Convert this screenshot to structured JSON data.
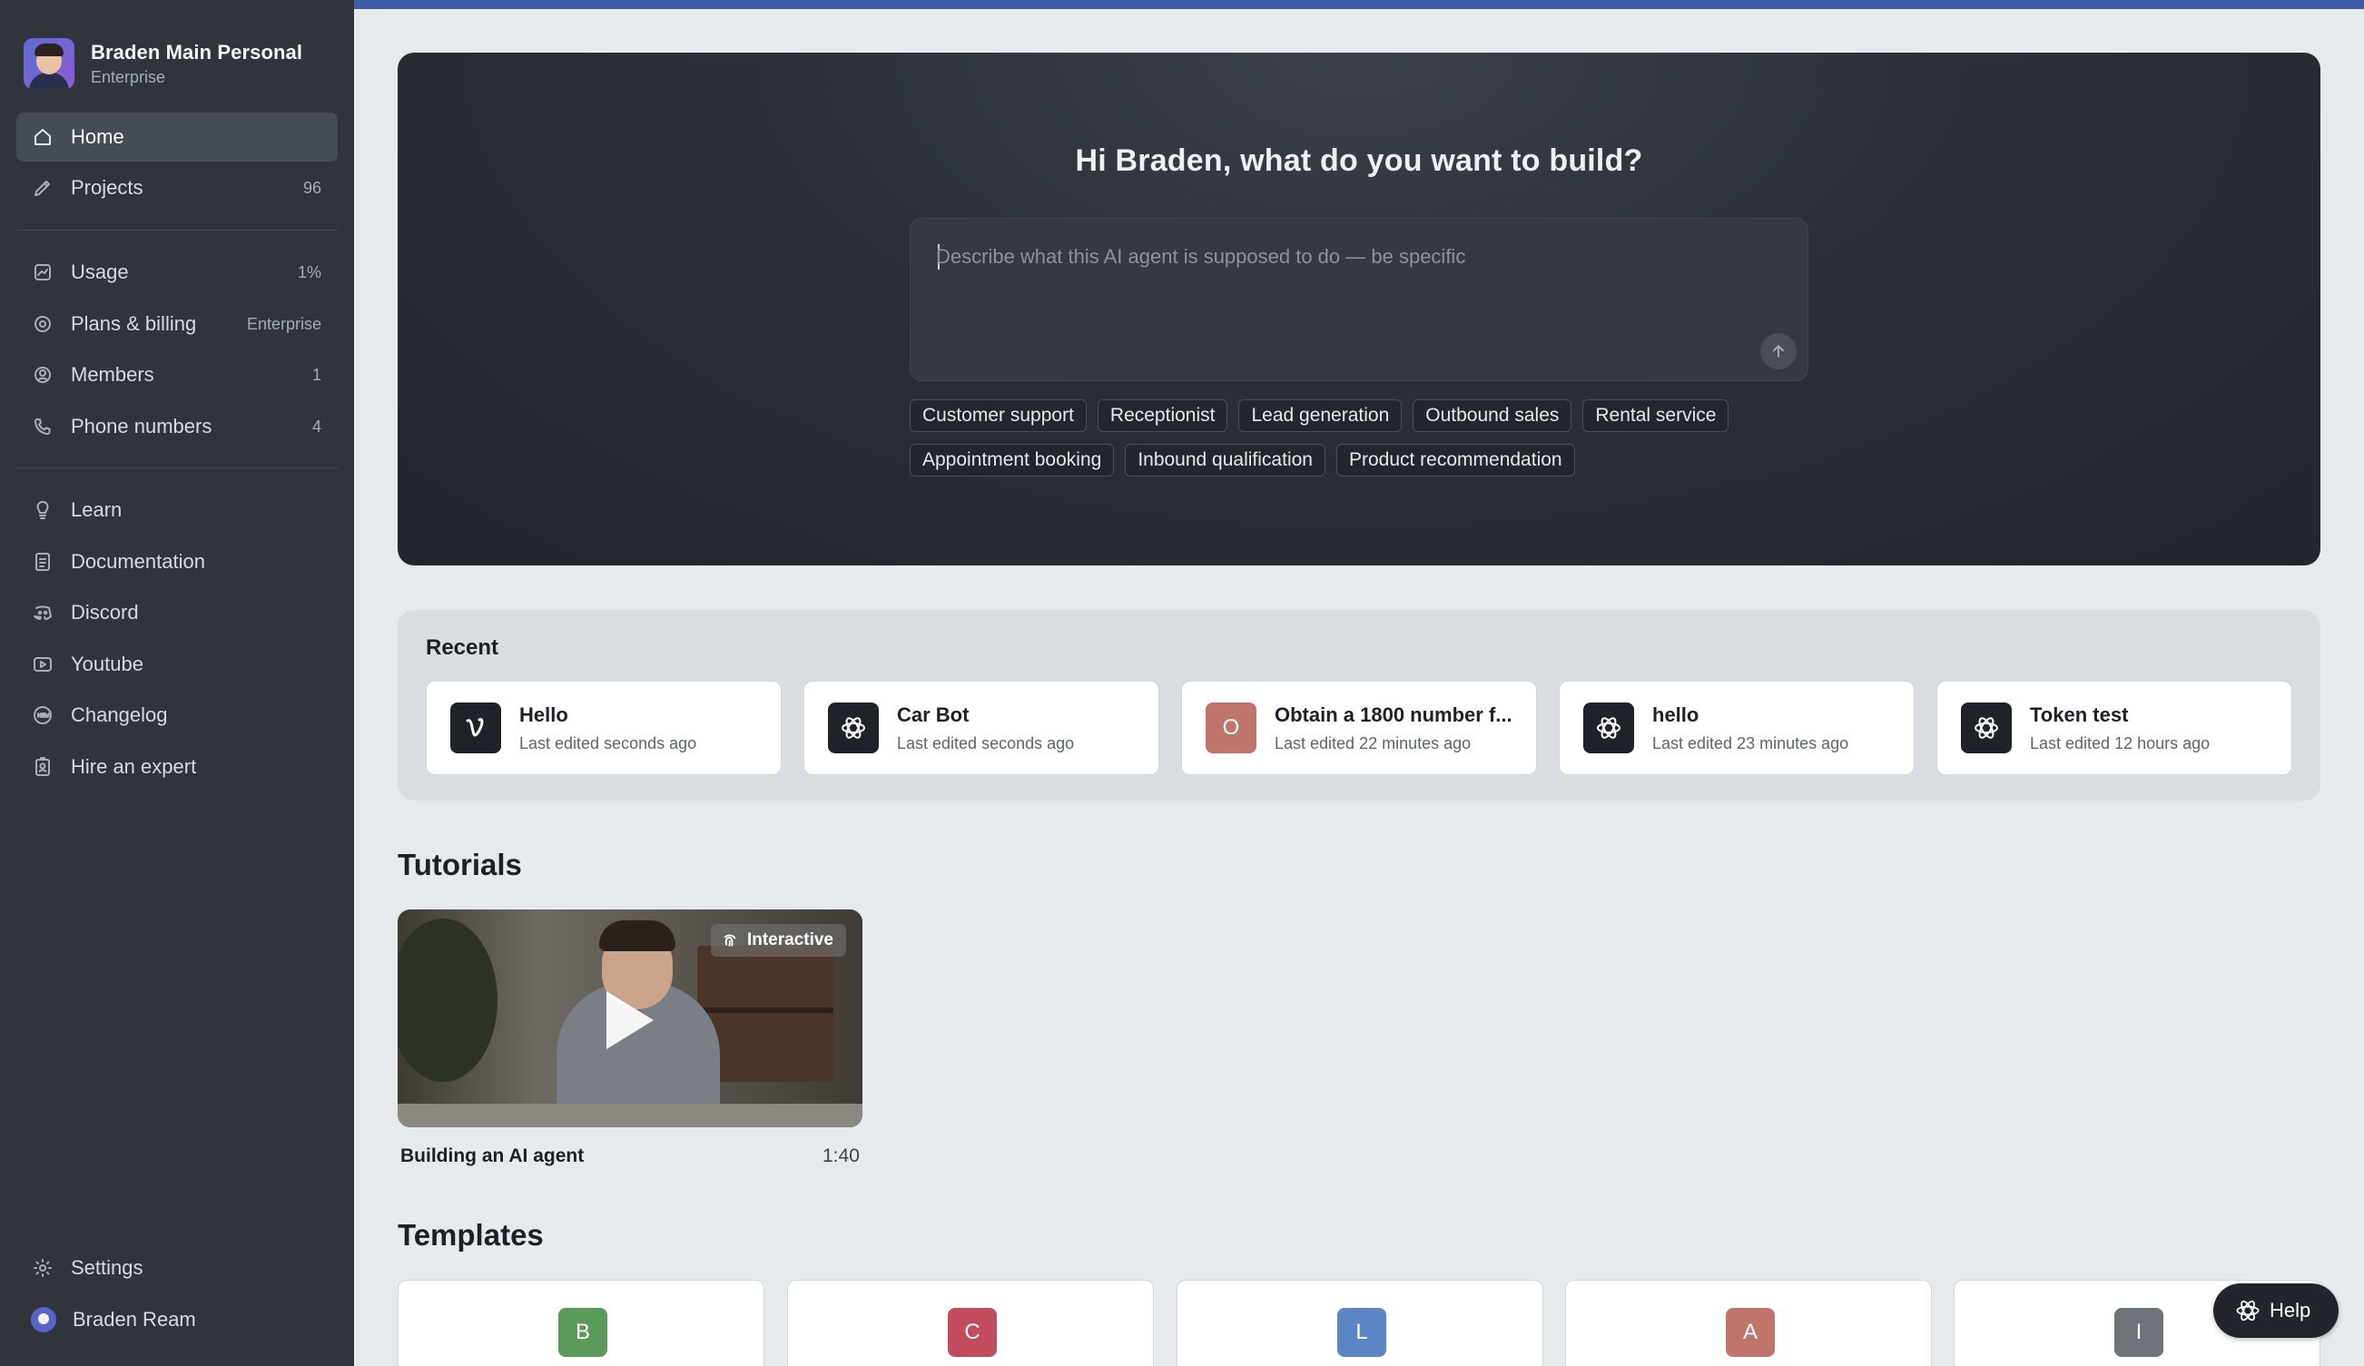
{
  "workspace": {
    "name": "Braden Main Personal",
    "plan": "Enterprise"
  },
  "nav": {
    "primary": [
      {
        "label": "Home",
        "meta": "",
        "icon": "home-icon",
        "active": true
      },
      {
        "label": "Projects",
        "meta": "96",
        "icon": "pencil-icon"
      }
    ],
    "account": [
      {
        "label": "Usage",
        "meta": "1%",
        "icon": "chart-icon"
      },
      {
        "label": "Plans & billing",
        "meta": "Enterprise",
        "icon": "billing-icon"
      },
      {
        "label": "Members",
        "meta": "1",
        "icon": "user-circle-icon"
      },
      {
        "label": "Phone numbers",
        "meta": "4",
        "icon": "phone-icon"
      }
    ],
    "resources": [
      {
        "label": "Learn",
        "icon": "lightbulb-icon"
      },
      {
        "label": "Documentation",
        "icon": "document-icon"
      },
      {
        "label": "Discord",
        "icon": "discord-icon"
      },
      {
        "label": "Youtube",
        "icon": "youtube-icon"
      },
      {
        "label": "Changelog",
        "icon": "new-badge-icon"
      },
      {
        "label": "Hire an expert",
        "icon": "badge-icon"
      }
    ],
    "settings_label": "Settings",
    "user_name": "Braden Ream"
  },
  "hero": {
    "title": "Hi Braden, what do you want to build?",
    "placeholder": "Describe what this AI agent is supposed to do — be specific",
    "chips_row1": [
      "Customer support",
      "Receptionist",
      "Lead generation",
      "Outbound sales",
      "Rental service"
    ],
    "chips_row2": [
      "Appointment booking",
      "Inbound qualification",
      "Product recommendation"
    ]
  },
  "recent": {
    "title": "Recent",
    "items": [
      {
        "name": "Hello",
        "meta": "Last edited seconds ago",
        "icon": "v-logo-icon"
      },
      {
        "name": "Car Bot",
        "meta": "Last edited seconds ago",
        "icon": "agent-logo-icon"
      },
      {
        "name": "Obtain a 1800 number f...",
        "meta": "Last edited 22 minutes ago",
        "icon": "letter-avatar",
        "letter": "O",
        "color": "#c0756c"
      },
      {
        "name": "hello",
        "meta": "Last edited 23 minutes ago",
        "icon": "agent-logo-icon"
      },
      {
        "name": "Token test",
        "meta": "Last edited 12 hours ago",
        "icon": "agent-logo-icon"
      }
    ]
  },
  "tutorials": {
    "title": "Tutorials",
    "video": {
      "title": "Building an AI agent",
      "duration": "1:40",
      "badge": "Interactive"
    }
  },
  "templates": {
    "title": "Templates",
    "items": [
      {
        "letter": "B",
        "color": "#5a9a5a"
      },
      {
        "letter": "C",
        "color": "#c44a5e"
      },
      {
        "letter": "L",
        "color": "#5b85c4"
      },
      {
        "letter": "A",
        "color": "#c0756c"
      },
      {
        "letter": "I",
        "color": "#6d7378"
      }
    ]
  },
  "help": {
    "label": "Help"
  }
}
